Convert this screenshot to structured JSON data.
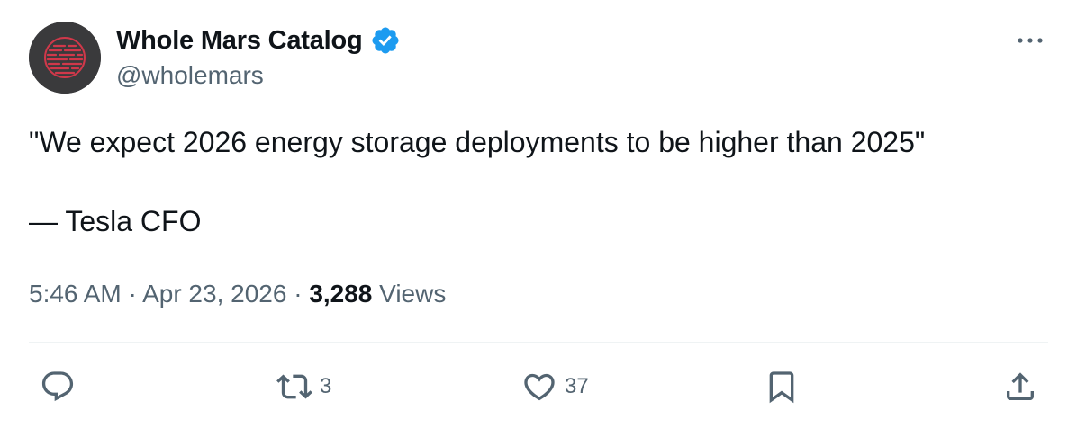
{
  "author": {
    "display_name": "Whole Mars Catalog",
    "handle": "@wholemars",
    "verified": true,
    "verified_color": "#1d9bf0",
    "avatar_bg": "#3a3a3c",
    "avatar_accent": "#d0384a"
  },
  "tweet": {
    "text": "\"We expect 2026 energy storage deployments to be higher than 2025\"\n\n— Tesla CFO"
  },
  "meta": {
    "time": "5:46 AM",
    "separator1": " · ",
    "date": "Apr 23, 2026",
    "separator2": " · ",
    "views_count": "3,288",
    "views_label": " Views"
  },
  "actions": {
    "reply": {
      "icon": "reply-icon",
      "count": ""
    },
    "retweet": {
      "icon": "retweet-icon",
      "count": "3"
    },
    "like": {
      "icon": "heart-icon",
      "count": "37"
    },
    "bookmark": {
      "icon": "bookmark-icon",
      "count": ""
    },
    "share": {
      "icon": "share-icon",
      "count": ""
    }
  },
  "colors": {
    "text_primary": "#0f1419",
    "text_secondary": "#536471",
    "divider": "#eff3f4"
  }
}
